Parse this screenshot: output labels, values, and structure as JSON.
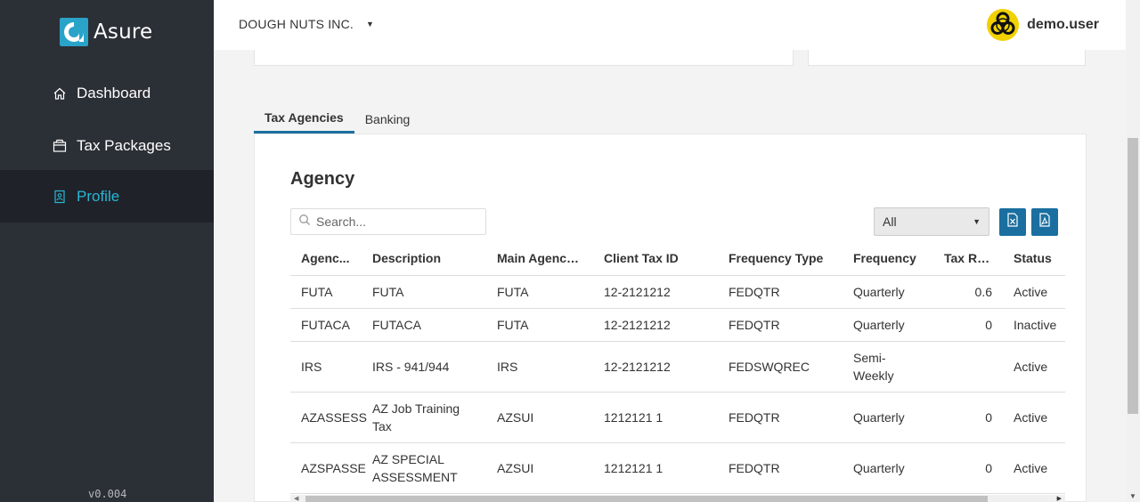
{
  "brand": {
    "name": "Asure",
    "color": "#2aa3c9"
  },
  "sidebar": {
    "items": [
      {
        "label": "Dashboard",
        "icon": "home-icon"
      },
      {
        "label": "Tax Packages",
        "icon": "package-icon"
      },
      {
        "label": "Profile",
        "icon": "profile-icon",
        "active": true
      }
    ],
    "version": "v0.004"
  },
  "header": {
    "company": "DOUGH NUTS INC.",
    "username": "demo.user",
    "avatar_icon": "biohazard-icon"
  },
  "tabs": [
    {
      "label": "Tax Agencies",
      "active": true
    },
    {
      "label": "Banking",
      "active": false
    }
  ],
  "agency": {
    "title": "Agency",
    "search_placeholder": "Search...",
    "filter_value": "All",
    "export_excel_icon": "excel-icon",
    "export_pdf_icon": "pdf-icon",
    "columns": [
      "Agenc...",
      "Description",
      "Main Agency ...",
      "Client Tax ID",
      "Frequency Type",
      "Frequency",
      "Tax Rate",
      "Status"
    ],
    "rows": [
      [
        "FUTA",
        "FUTA",
        "FUTA",
        "12-2121212",
        "FEDQTR",
        "Quarterly",
        "0.6",
        "Active"
      ],
      [
        "FUTACA",
        "FUTACA",
        "FUTA",
        "12-2121212",
        "FEDQTR",
        "Quarterly",
        "0",
        "Inactive"
      ],
      [
        "IRS",
        "IRS - 941/944",
        "IRS",
        "12-2121212",
        "FEDSWQREC",
        "Semi-Weekly",
        "",
        "Active"
      ],
      [
        "AZASSESS",
        "AZ Job Training Tax",
        "AZSUI",
        "1212121 1",
        "FEDQTR",
        "Quarterly",
        "0",
        "Active"
      ],
      [
        "AZSPASSE",
        "AZ SPECIAL ASSESSMENT",
        "AZSUI",
        "1212121 1",
        "FEDQTR",
        "Quarterly",
        "0",
        "Active"
      ]
    ]
  },
  "colors": {
    "sidebar_bg": "#2b2f36",
    "active_nav": "#29b6d6",
    "primary_button": "#1a6fa0",
    "avatar_bg": "#f1d100"
  }
}
